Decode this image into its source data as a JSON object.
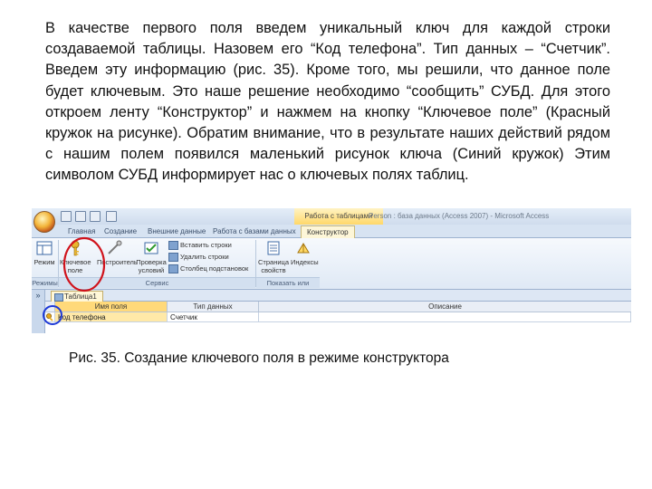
{
  "paragraph": "В качестве первого поля введем уникальный ключ для каждой строки создаваемой таблицы. Назовем его “Код телефона”. Тип данных – “Счетчик”. Введем эту информацию (рис. 35). Кроме того, мы решили, что данное поле будет ключевым. Это наше решение необходимо “сообщить” СУБД. Для этого откроем ленту “Конструктор” и нажмем на кнопку “Ключевое поле” (Красный кружок на рисунке). Обратим внимание, что в результате наших действий рядом с нашим полем появился маленький рисунок ключа (Синий кружок)  Этим символом СУБД информирует нас о ключевых полях таблиц.",
  "screenshot": {
    "context_tab": "Работа с таблицами",
    "window_title": "Person : база данных (Access 2007) - Microsoft Access",
    "tabs": [
      "Главная",
      "Создание",
      "Внешние данные",
      "Работа с базами данных",
      "Конструктор"
    ],
    "ribbon": {
      "view_label": "Режим",
      "key_field_label": "Ключевое поле",
      "builder_label": "Построитель",
      "check_rules_label": "Проверка условий",
      "insert_rows": "Вставить строки",
      "delete_rows": "Удалить строки",
      "lookup_column": "Столбец подстановок",
      "property_sheet_label": "Страница свойств",
      "indexes_label": "Индексы",
      "groups": {
        "views": "Режимы",
        "service": "Сервис",
        "show_hide": "Показать или скрыть"
      }
    },
    "nav_toggle": "»",
    "doc_tab": "Таблица1",
    "columns": {
      "field_name": "Имя поля",
      "data_type": "Тип данных",
      "description": "Описание"
    },
    "row": {
      "field_name": "Код телефона",
      "data_type": "Счетчик"
    },
    "colors": {
      "red_circle": "#d0121b",
      "blue_circle": "#1d39d6"
    }
  },
  "caption": "Рис. 35. Создание ключевого поля в режиме конструктора"
}
